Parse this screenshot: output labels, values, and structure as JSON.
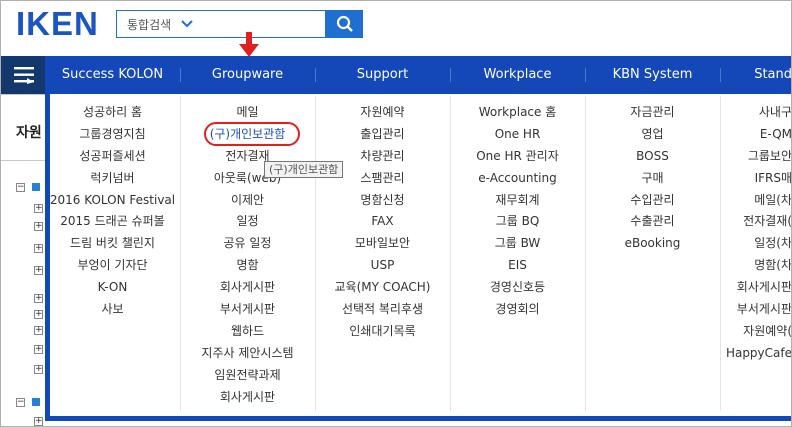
{
  "header": {
    "logo": "IKEN",
    "search_select": "통합검색"
  },
  "background": {
    "page_title": "자원"
  },
  "menu": {
    "columns": [
      {
        "title": "Success KOLON",
        "items": [
          "성공하리 홈",
          "그룹경영지침",
          "성공퍼즐세션",
          "럭키넘버",
          "2016 KOLON Festival",
          "2015 드래곤 슈퍼볼",
          "드림 버킷 챌린지",
          "부엉이 기자단",
          "K-ON",
          "사보"
        ]
      },
      {
        "title": "Groupware",
        "items": [
          "메일",
          "(구)개인보관함",
          "전자결재",
          "아웃룩(web)",
          "이제안",
          "일정",
          "공유 일정",
          "명함",
          "회사게시판",
          "부서게시판",
          "웹하드",
          "지주사 제안시스템",
          "임원전략과제",
          "회사게시판"
        ]
      },
      {
        "title": "Support",
        "items": [
          "자원예약",
          "출입관리",
          "차량관리",
          "스팸관리",
          "명함신청",
          "FAX",
          "모바일보안",
          "USP",
          "교육(MY COACH)",
          "선택적 복리후생",
          "인쇄대기목록"
        ]
      },
      {
        "title": "Workplace",
        "items": [
          "Workplace 홈",
          "One HR",
          "One HR 관리자",
          "e-Accounting",
          "재무회계",
          "그룹 BQ",
          "그룹 BW",
          "EIS",
          "경영신호등",
          "경영회의"
        ]
      },
      {
        "title": "KBN System",
        "items": [
          "자금관리",
          "영업",
          "BOSS",
          "구매",
          "수입관리",
          "수출관리",
          "eBooking"
        ]
      },
      {
        "title": "Stand",
        "items": [
          "사내구",
          "E-QM",
          "그룹보안",
          "IFRS매",
          "메일(차",
          "전자결재(",
          "일정(차",
          "명함(차",
          "회사게시판",
          "부서게시판",
          "자원예약(",
          "HappyCafe"
        ]
      }
    ],
    "tooltip": "(구)개인보관함"
  },
  "colors": {
    "brand_blue": "#1447b8",
    "logo_blue": "#1b55c3",
    "highlight_red": "#e02020"
  }
}
